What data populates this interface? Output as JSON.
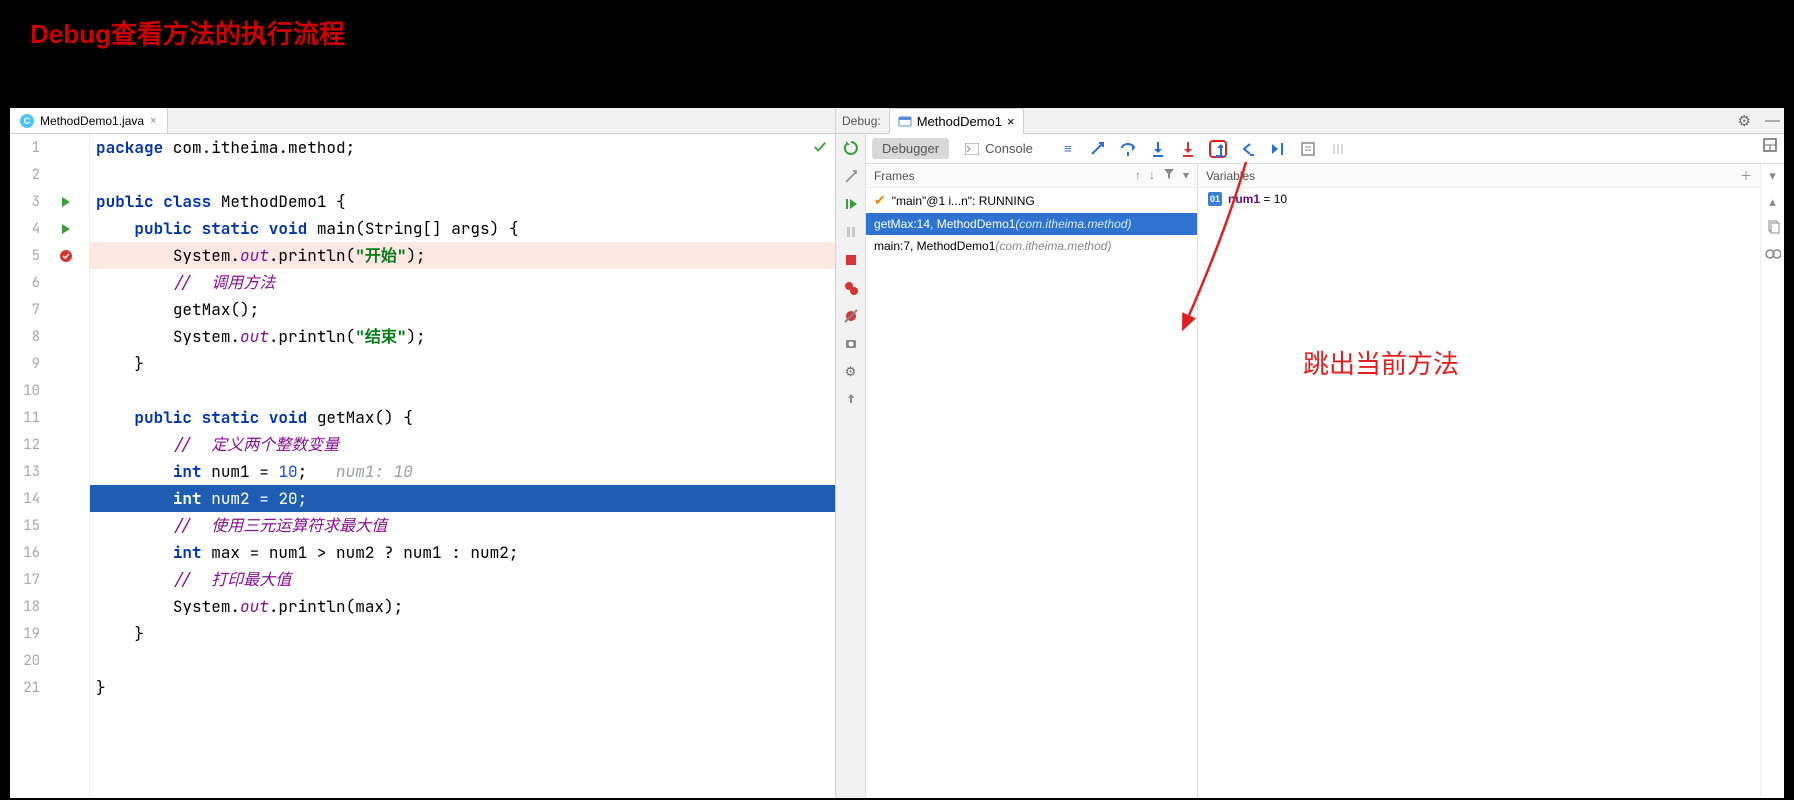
{
  "page_title": "Debug查看方法的执行流程",
  "editor": {
    "tab_filename": "MethodDemo1.java",
    "lines": {
      "l1_package": "package",
      "l1_rest": " com.itheima.method;",
      "l3_public": "public",
      "l3_class": " class",
      "l3_name": " MethodDemo1 {",
      "l4_mods": "public static void",
      "l4_main": " main",
      "l4_sig": "(String[] args) {",
      "l5_pre": "System.",
      "l5_out": "out",
      "l5_post": ".println(",
      "l5_str": "\"开始\"",
      "l5_end": ");",
      "l6_cm": "//  调用方法",
      "l7": "getMax();",
      "l8_pre": "System.",
      "l8_out": "out",
      "l8_post": ".println(",
      "l8_str": "\"结束\"",
      "l8_end": ");",
      "l9": "}",
      "l11_mods": "public static void",
      "l11_name": " getMax",
      "l11_sig": "() {",
      "l12_cm": "//  定义两个整数变量",
      "l13_int": "int",
      "l13_rest": " num1 = ",
      "l13_num": "10",
      "l13_semi": ";",
      "l13_hint": "   num1: 10",
      "l14_int": "int",
      "l14_rest": " num2 = ",
      "l14_num": "20",
      "l14_semi": ";",
      "l15_cm": "//  使用三元运算符求最大值",
      "l16_int": "int",
      "l16_rest": " max = num1 > num2 ? num1 : num2;",
      "l17_cm": "//  打印最大值",
      "l18_pre": "System.",
      "l18_out": "out",
      "l18_post": ".println(max);",
      "l19": "}",
      "l21": "}"
    }
  },
  "debug": {
    "label": "Debug:",
    "config_name": "MethodDemo1",
    "tabs": {
      "debugger": "Debugger",
      "console": "Console"
    },
    "frames_header": "Frames",
    "variables_header": "Variables",
    "thread": "\"main\"@1 i...n\": RUNNING",
    "frame1_a": "getMax:14, MethodDemo1 ",
    "frame1_pkg": "(com.itheima.method)",
    "frame2_a": "main:7, MethodDemo1 ",
    "frame2_pkg": "(com.itheima.method)",
    "var1_name": "num1",
    "var1_val": " = 10"
  },
  "annotation": {
    "step_out_label": "跳出当前方法"
  },
  "gutter": {
    "lines": [
      "1",
      "2",
      "3",
      "4",
      "5",
      "6",
      "7",
      "8",
      "9",
      "10",
      "11",
      "12",
      "13",
      "14",
      "15",
      "16",
      "17",
      "18",
      "19",
      "20",
      "21"
    ]
  }
}
